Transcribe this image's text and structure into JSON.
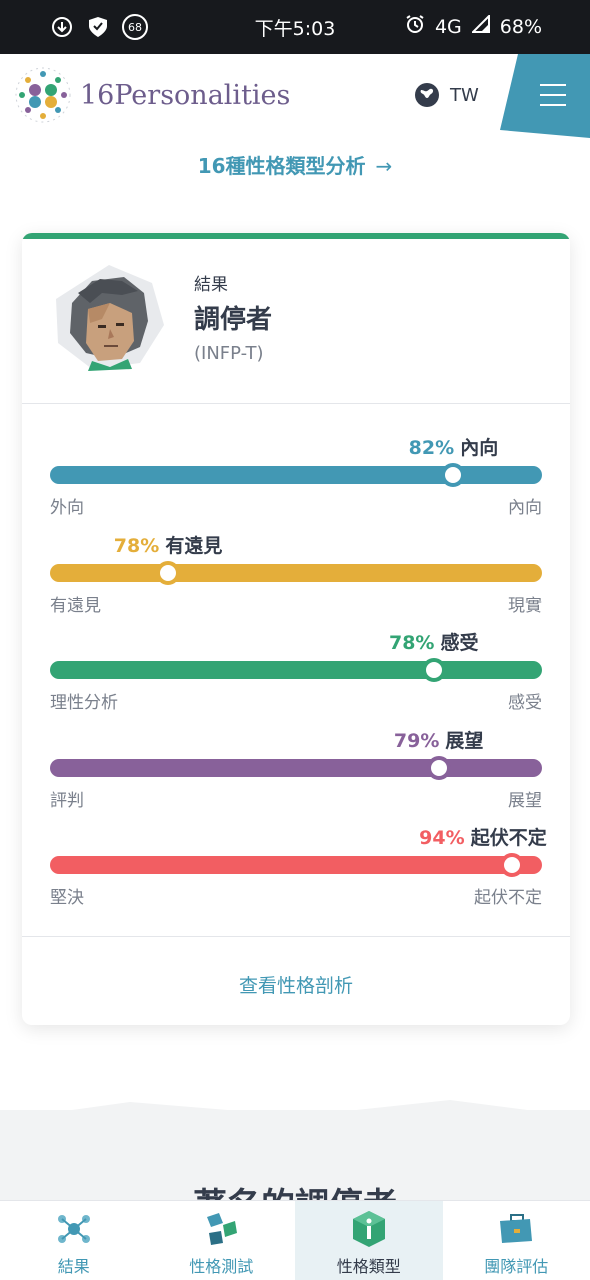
{
  "status_bar": {
    "time": "下午5:03",
    "notification_badge": "68",
    "network": "4G",
    "battery": "68%"
  },
  "header": {
    "logo_text": "16Personalities",
    "language": "TW"
  },
  "analysis_link": "16種性格類型分析",
  "result": {
    "label": "結果",
    "type_name": "調停者",
    "type_code": "(INFP-T)"
  },
  "traits": [
    {
      "pct_text": "82%",
      "name": "內向",
      "percent": 82,
      "left_label": "外向",
      "right_label": "內向",
      "color": "#4298b4"
    },
    {
      "pct_text": "78%",
      "name": "有遠見",
      "percent": 24,
      "left_label": "有遠見",
      "right_label": "現實",
      "color": "#e4ae3a"
    },
    {
      "pct_text": "78%",
      "name": "感受",
      "percent": 78,
      "left_label": "理性分析",
      "right_label": "感受",
      "color": "#33a474"
    },
    {
      "pct_text": "79%",
      "name": "展望",
      "percent": 79,
      "left_label": "評判",
      "right_label": "展望",
      "color": "#88619a"
    },
    {
      "pct_text": "94%",
      "name": "起伏不定",
      "percent": 94,
      "left_label": "堅決",
      "right_label": "起伏不定",
      "color": "#f25e62"
    }
  ],
  "view_analysis": "查看性格剖析",
  "next_section_title": "著名的調停者",
  "bottom_nav": [
    {
      "label": "結果",
      "icon": "molecule-icon",
      "active": false
    },
    {
      "label": "性格測試",
      "icon": "puzzle-cubes-icon",
      "active": false
    },
    {
      "label": "性格類型",
      "icon": "info-cube-icon",
      "active": true
    },
    {
      "label": "團隊評估",
      "icon": "briefcase-icon",
      "active": false
    }
  ]
}
